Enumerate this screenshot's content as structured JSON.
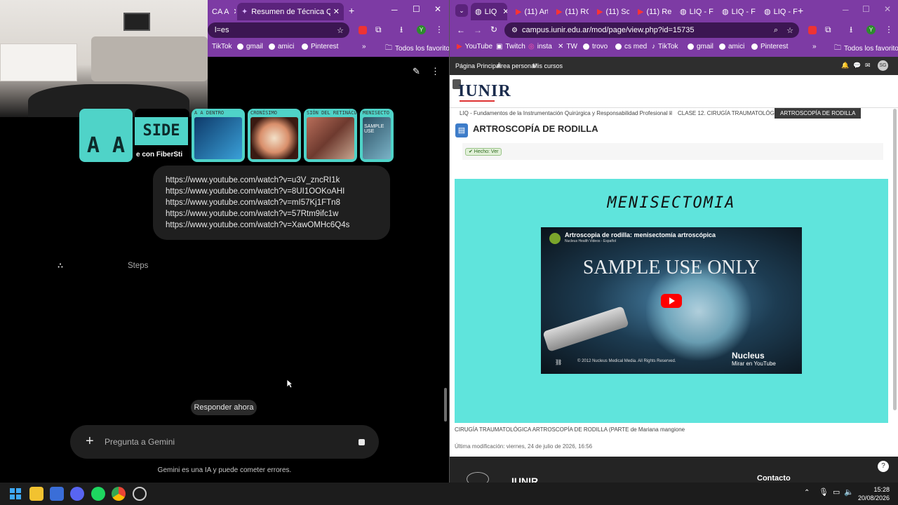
{
  "left_window": {
    "tabs": [
      {
        "label": "CA A"
      },
      {
        "label": "Resumen de Técnica Quirúrgic"
      }
    ],
    "address": "l=es",
    "bookmarks": [
      "TikTok",
      "gmail",
      "amici",
      "Pinterest"
    ],
    "all_bookmarks": "Todos los favoritos",
    "thumbnails": [
      {
        "label": "A A"
      },
      {
        "label": "SIDE",
        "caption": "e con FiberSti"
      },
      {
        "caption": "A A DENTRO"
      },
      {
        "caption": "CRONÍSIMO"
      },
      {
        "caption": "SIÓN DEL RETINÁCULO LA"
      },
      {
        "caption": "MENISECTO",
        "label": "SAMPLE USE"
      }
    ],
    "urls": [
      "https://www.youtube.com/watch?v=u3V_zncRI1k",
      "https://www.youtube.com/watch?v=8UI1OOKoAHI",
      "https://www.youtube.com/watch?v=mI57Kj1FTn8",
      "https://www.youtube.com/watch?v=57Rtm9ifc1w",
      "https://www.youtube.com/watch?v=XawOMHc6Q4s"
    ],
    "steps_text": "Steps",
    "respond_now": "Responder ahora",
    "input_placeholder": "Pregunta a Gemini",
    "disclaimer": "Gemini es una IA y puede cometer errores."
  },
  "right_window": {
    "tabs": [
      {
        "label": "LIQ"
      },
      {
        "label": "(11) Art"
      },
      {
        "label": "(11) RO"
      },
      {
        "label": "(11) Sc"
      },
      {
        "label": "(11) Re"
      },
      {
        "label": "LIQ - F"
      },
      {
        "label": "LIQ - F"
      },
      {
        "label": "LIQ - F"
      }
    ],
    "address": "campus.iunir.edu.ar/mod/page/view.php?id=15735",
    "bookmarks": [
      "YouTube",
      "Twitch",
      "insta",
      "TW",
      "trovo",
      "cs med",
      "TikTok",
      "gmail",
      "amici",
      "Pinterest"
    ],
    "all_bookmarks": "Todos los favoritos",
    "nav_links": [
      "Página Principal",
      "Área personal",
      "Mis cursos"
    ],
    "avatar_initials": "SG",
    "logo": "IUNIR",
    "breadcrumbs": [
      "LIQ - Fundamentos de la Instrumentación Quirúrgica y Responsabilidad Profesional II",
      "CLASE 12. CIRUGÍA TRAUMATOLÓGICA",
      "ARTROSCOPÍA DE RODILLA"
    ],
    "page_title": "ARTROSCOPÍA DE RODILLA",
    "done_chip": "✔ Hecho: Ver",
    "video_heading": "MENISECTOMIA",
    "video": {
      "title": "Artroscopia de rodilla: menisectomía artroscópica",
      "channel": "Nucleus Health Videos - Español",
      "watermark": "SAMPLE USE ONLY",
      "copyright": "© 2012 Nucleus Medical Media. All Rights Reserved.",
      "brand": "Nucleus",
      "watch_on": "Mirar en YouTube"
    },
    "caption": "CIRUGÍA TRAUMATOLÓGICA ARTROSCOPÍA DE RODILLA (PARTE de Mariana mangione",
    "modified": "Última modificación: viernes, 24 de julio de 2026, 16:56",
    "footer_contact": "Contacto",
    "footer_logo": "IUNIR"
  },
  "taskbar": {
    "time": "15:28",
    "date": "20/08/2026"
  },
  "colors": {
    "browser_purple": "#7d3ba4",
    "cyan_card": "#5fe4dc",
    "youtube_red": "#ff0000"
  }
}
